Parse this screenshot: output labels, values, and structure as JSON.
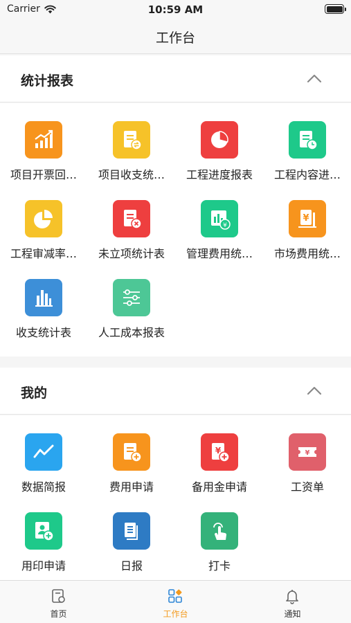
{
  "status_bar": {
    "carrier": "Carrier",
    "time": "10:59 AM"
  },
  "nav": {
    "title": "工作台"
  },
  "sections": [
    {
      "title": "统计报表",
      "items": [
        {
          "label": "项目开票回…",
          "icon": "chart-up-icon",
          "color": "#f7941d"
        },
        {
          "label": "项目收支统…",
          "icon": "document-exchange-icon",
          "color": "#f6c229"
        },
        {
          "label": "工程进度报表",
          "icon": "pie-progress-icon",
          "color": "#ee3f3f"
        },
        {
          "label": "工程内容进…",
          "icon": "document-clock-icon",
          "color": "#1ec98a"
        },
        {
          "label": "工程审减率…",
          "icon": "pie-chart-icon",
          "color": "#f6c229"
        },
        {
          "label": "未立项统计表",
          "icon": "document-cancel-icon",
          "color": "#ee3f3f"
        },
        {
          "label": "管理费用统…",
          "icon": "bar-yen-icon",
          "color": "#1ec98a"
        },
        {
          "label": "市场费用统…",
          "icon": "yen-stand-icon",
          "color": "#f7941d"
        },
        {
          "label": "收支统计表",
          "icon": "bar-chart-icon",
          "color": "#3d8fd8"
        },
        {
          "label": "人工成本报表",
          "icon": "sliders-icon",
          "color": "#4dc796"
        }
      ]
    },
    {
      "title": "我的",
      "items": [
        {
          "label": "数据简报",
          "icon": "line-chart-icon",
          "color": "#2aa5ef"
        },
        {
          "label": "费用申请",
          "icon": "document-add-icon",
          "color": "#f7941d"
        },
        {
          "label": "备用金申请",
          "icon": "yen-add-icon",
          "color": "#ee3f3f"
        },
        {
          "label": "工资单",
          "icon": "yen-ticket-icon",
          "color": "#e0606b"
        },
        {
          "label": "用印申请",
          "icon": "stamp-add-icon",
          "color": "#1ec98a"
        },
        {
          "label": "日报",
          "icon": "daily-report-icon",
          "color": "#2e7bc4"
        },
        {
          "label": "打卡",
          "icon": "tap-finger-icon",
          "color": "#34b27a"
        }
      ]
    }
  ],
  "tabs": [
    {
      "label": "首页",
      "icon": "home-doc-icon",
      "active": false
    },
    {
      "label": "工作台",
      "icon": "workbench-grid-icon",
      "active": true
    },
    {
      "label": "通知",
      "icon": "bell-icon",
      "active": false
    }
  ],
  "colors": {
    "accent": "#f39a1e",
    "tab_inactive": "#666666"
  }
}
